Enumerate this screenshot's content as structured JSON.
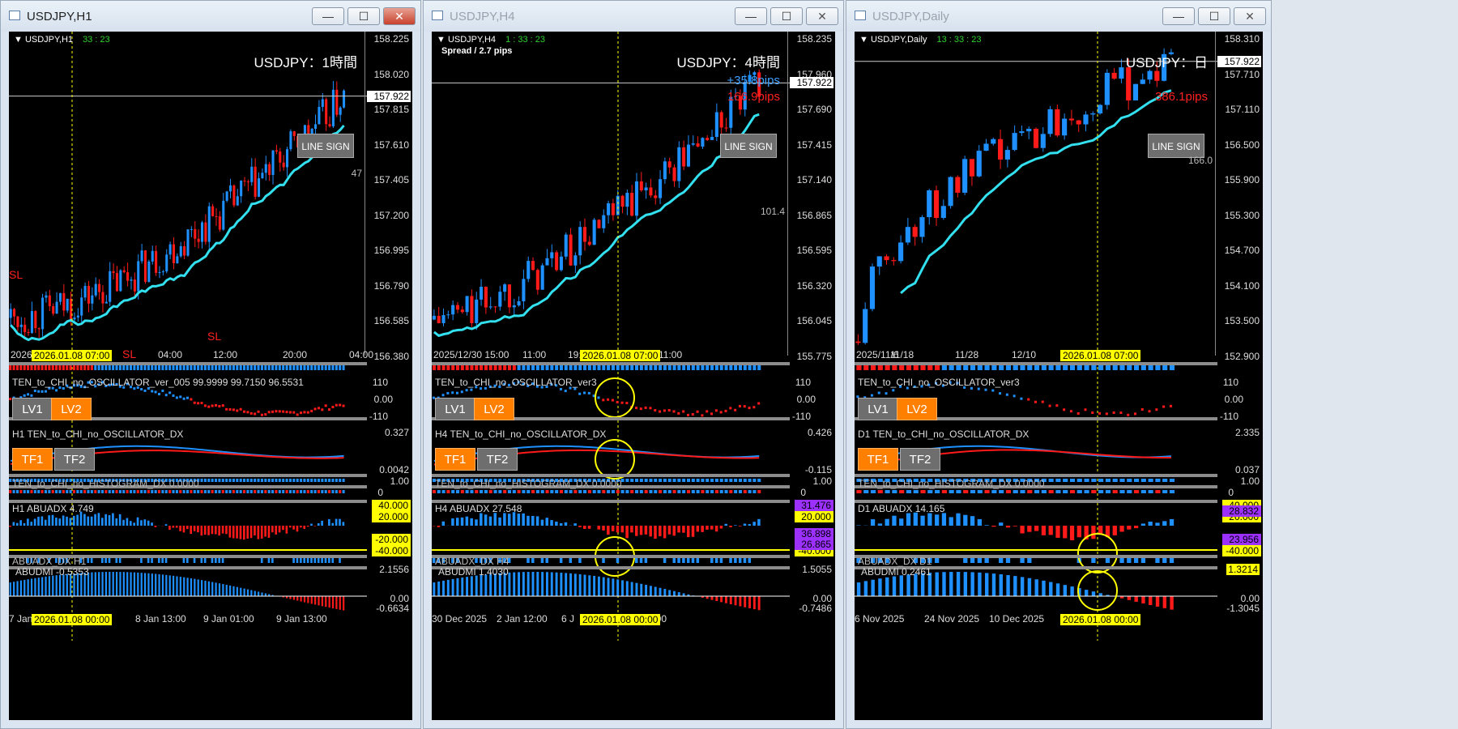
{
  "windows": [
    {
      "title": "USDJPY,H1",
      "active": true,
      "symbol": "USDJPY,H1",
      "timer": "33 : 23",
      "big_title": "USDJPY：1時間",
      "pips_up": "",
      "pips_down": "",
      "line_sign": "LINE SIGN",
      "price_ticks": [
        "158.225",
        "158.020",
        "157.815",
        "157.610",
        "157.405",
        "157.200",
        "156.995",
        "156.790",
        "156.585",
        "156.380"
      ],
      "current_price": "157.922",
      "ma_label": "47",
      "sl_labels": [
        "SL",
        "SL",
        "SL"
      ],
      "date_axis": [
        "2026/",
        "20:00",
        "04:00",
        "12:00",
        "20:00",
        "04:00"
      ],
      "date_tag": "2026.01.08 07:00",
      "osc_title": "TEN_to_CHI_no_OSCILLATOR_ver_005 99.9999 99.7150 96.5531",
      "osc_ticks": [
        "110",
        "0.00",
        "-110"
      ],
      "lv_buttons": [
        "LV1",
        "LV2"
      ],
      "dx_title": "H1 TEN_to_CHI_no_OSCILLATOR_DX",
      "dx_ticks": [
        "0.327",
        "0.0042"
      ],
      "tf_buttons": [
        "TF1",
        "TF2"
      ],
      "hist_title": "TEN_to_CHI_no_HISTOGRAM_DX 0.0000",
      "hist_ticks": [
        "1.00",
        "0"
      ],
      "abuadx_title": "H1 ABUADX  4.749",
      "abuadx_boxes": [
        "40.000",
        "20.000",
        "-20.000",
        "-40.000"
      ],
      "abuadx_bar_title": "ABUADX_DX H1",
      "abudmi_title": "ABUDMI  -0.5353",
      "abudmi_ticks": [
        "2.1556",
        "0.00",
        "-0.6634"
      ],
      "bottom_axis": [
        "7 Jan",
        "8 Jan 13:00",
        "9 Jan 01:00",
        "9 Jan 13:00"
      ],
      "bottom_tag": "2026.01.08 00:00"
    },
    {
      "title": "USDJPY,H4",
      "active": false,
      "symbol": "USDJPY,H4",
      "timer": "1 : 33 : 23",
      "spread": "Spread / 2.7 pips",
      "big_title": "USDJPY：4時間",
      "pips_up": "+35.8pips",
      "pips_down": "166.9pips",
      "line_sign": "LINE SIGN",
      "price_ticks": [
        "158.235",
        "157.960",
        "157.690",
        "157.415",
        "157.140",
        "156.865",
        "156.595",
        "156.320",
        "156.045",
        "155.775"
      ],
      "current_price": "157.922",
      "ma_label": "101.4",
      "sl_labels": [],
      "date_axis": [
        "2025/12/30 15:00",
        "11:00",
        "19:",
        "11:00"
      ],
      "date_tag": "2026.01.08 07:00",
      "osc_title": "TEN_to_CHI_no_OSCILLATOR_ver3",
      "osc_ticks": [
        "110",
        "0.00",
        "-110"
      ],
      "lv_buttons": [
        "LV1",
        "LV2"
      ],
      "dx_title": "H4 TEN_to_CHI_no_OSCILLATOR_DX",
      "dx_ticks": [
        "0.426",
        "-0.115"
      ],
      "tf_buttons": [
        "TF1",
        "TF2"
      ],
      "hist_title": "TEN_to_CHI_no_HISTOGRAM_DX 0.0000",
      "hist_ticks": [
        "1.00",
        "0"
      ],
      "abuadx_title": "H4 ABUADX  27.548",
      "abuadx_boxes": [
        "31.476",
        "20.000",
        "-20.000",
        "-40.000"
      ],
      "abuadx_purple": [
        "36.898",
        "26.865"
      ],
      "abuadx_bar_title": "ABUADX_DX H4",
      "abudmi_title": "ABUDMI  1.4030",
      "abudmi_ticks": [
        "1.5055",
        "0.00",
        "-0.7486"
      ],
      "bottom_axis": [
        "30 Dec 2025",
        "2 Jan 12:00",
        "6 J",
        "12:00"
      ],
      "bottom_tag": "2026.01.08 00:00"
    },
    {
      "title": "USDJPY,Daily",
      "active": false,
      "symbol": "USDJPY,Daily",
      "timer": "13 : 33 : 23",
      "big_title": "USDJPY：日",
      "pips_up": "",
      "pips_down": "386.1pips",
      "line_sign": "LINE SIGN",
      "price_ticks": [
        "158.310",
        "157.710",
        "157.110",
        "156.500",
        "155.900",
        "155.300",
        "154.700",
        "154.100",
        "153.500",
        "152.900"
      ],
      "current_price": "157.922",
      "ma_label": "166.0",
      "sl_labels": [],
      "date_axis": [
        "2025/11/6",
        "11/18",
        "11/28",
        "12/10",
        "12/22"
      ],
      "date_tag": "2026.01.08 07:00",
      "osc_title": "TEN_to_CHI_no_OSCILLATOR_ver3",
      "osc_ticks": [
        "110",
        "0.00",
        "-110"
      ],
      "lv_buttons": [
        "LV1",
        "LV2"
      ],
      "dx_title": "D1 TEN_to_CHI_no_OSCILLATOR_DX",
      "dx_ticks": [
        "2.335",
        "0.037"
      ],
      "tf_buttons": [
        "TF1",
        "TF2"
      ],
      "hist_title": "TEN_to_CHI_no_HISTOGRAM_DX 0.0000",
      "hist_ticks": [
        "1.00",
        "0"
      ],
      "abuadx_title": "D1 ABUADX  14.165",
      "abuadx_boxes": [
        "40.000",
        "20.000",
        "-20.000",
        "-40.000"
      ],
      "abuadx_purple": [
        "28.832",
        "23.956"
      ],
      "abuadx_bar_title": "ABUADX_DX D1",
      "abudmi_title": "ABUDMI  0.2461",
      "abudmi_ticks": [
        "1.3214",
        "0.00",
        "-1.3045"
      ],
      "bottom_axis": [
        "6 Nov 2025",
        "24 Nov 2025",
        "10 Dec 2025"
      ],
      "bottom_tag": "2026.01.08 00:00"
    }
  ],
  "colors": {
    "bull": "#1e90ff",
    "bear": "#ff1a1a",
    "ma": "#33e0f0",
    "accent_yellow": "#ffff00",
    "purple": "#9b30ff",
    "orange": "#ff8000"
  },
  "controls": {
    "minimize": "—",
    "maximize": "☐",
    "close": "✕"
  }
}
